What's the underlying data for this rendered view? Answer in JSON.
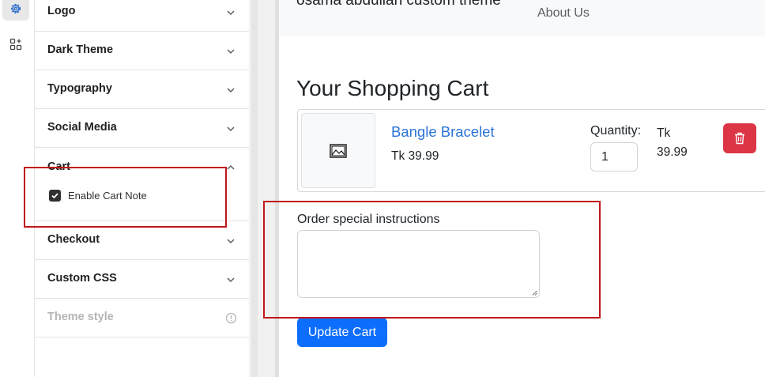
{
  "rail": {
    "items": [
      {
        "icon": "gear-icon",
        "active": true
      },
      {
        "icon": "apps-add-icon",
        "active": false
      }
    ]
  },
  "settings": {
    "sections": [
      {
        "key": "logo",
        "label": "Logo",
        "state": "collapsed"
      },
      {
        "key": "dark_theme",
        "label": "Dark Theme",
        "state": "collapsed"
      },
      {
        "key": "typography",
        "label": "Typography",
        "state": "collapsed"
      },
      {
        "key": "social_media",
        "label": "Social Media",
        "state": "collapsed"
      },
      {
        "key": "cart",
        "label": "Cart",
        "state": "expanded"
      },
      {
        "key": "checkout",
        "label": "Checkout",
        "state": "collapsed"
      },
      {
        "key": "custom_css",
        "label": "Custom CSS",
        "state": "collapsed"
      },
      {
        "key": "theme_style",
        "label": "Theme style",
        "state": "disabled"
      }
    ],
    "cart_option": {
      "label": "Enable Cart Note",
      "checked": true
    }
  },
  "preview": {
    "brand": "osama abdullah custom theme",
    "nav": {
      "about": "About Us"
    },
    "cart_title": "Your Shopping Cart",
    "item": {
      "name": "Bangle Bracelet",
      "price": "Tk 39.99",
      "quantity_label": "Quantity:",
      "quantity": "1",
      "total_currency": "Tk",
      "total_amount": "39.99"
    },
    "note_label": "Order special instructions",
    "note_value": "",
    "update_button": "Update Cart"
  },
  "colors": {
    "accent_blue": "#0d6efd",
    "link_blue": "#2a74d8",
    "danger_red": "#dc3545",
    "highlight_red": "#c0171b"
  }
}
